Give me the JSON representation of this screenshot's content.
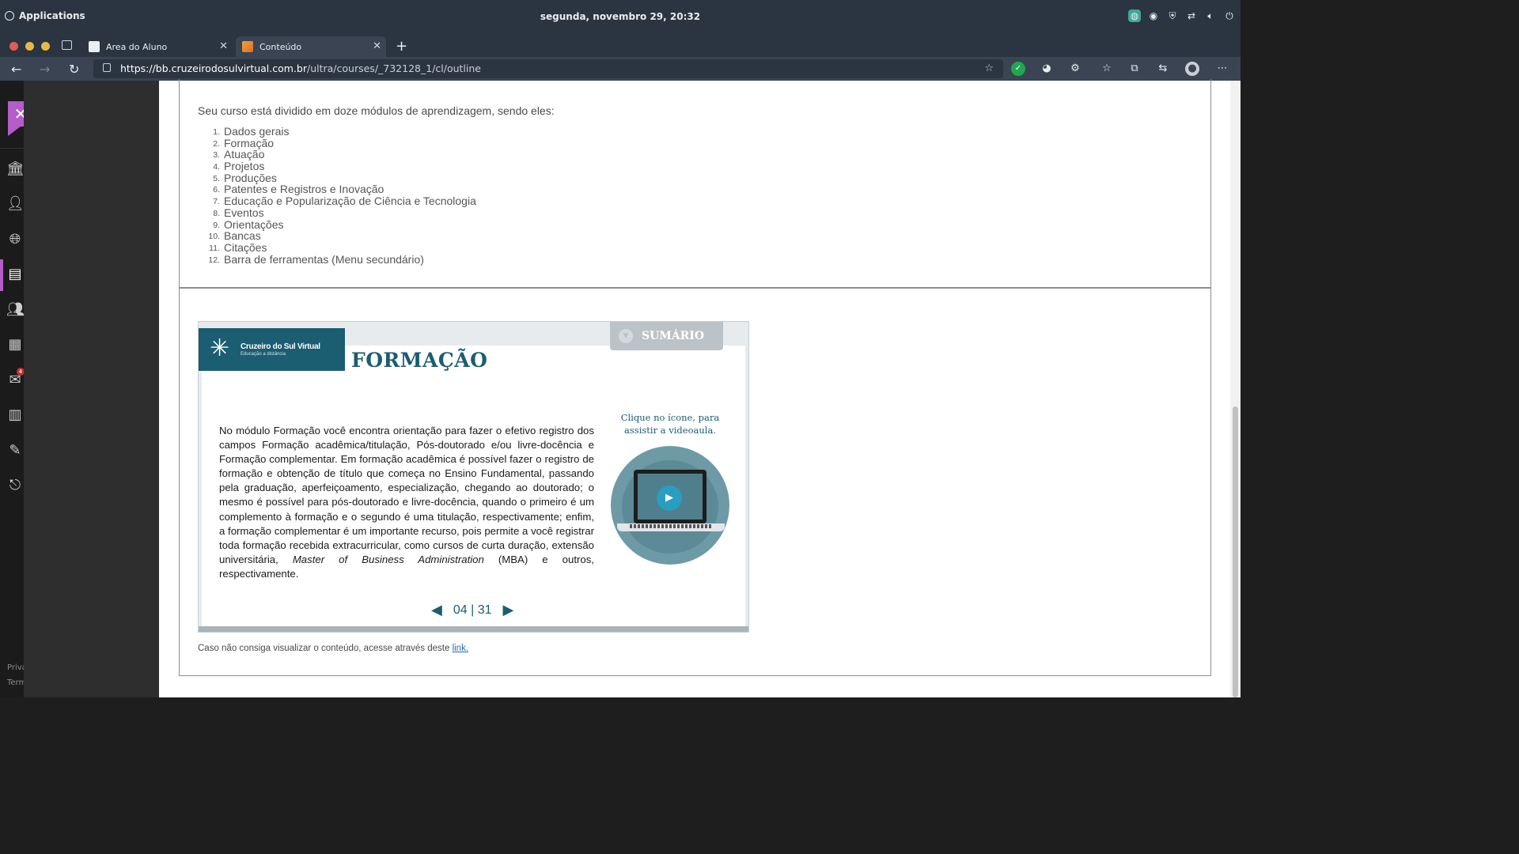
{
  "system": {
    "apps_label": "Applications",
    "clock": "segunda, novembro 29, 20:32",
    "tray_icons": [
      "browser-icon",
      "discord-icon",
      "shield-icon",
      "network-icon",
      "volume-icon",
      "power-icon"
    ]
  },
  "browser": {
    "tabs": [
      {
        "label": "Area do Aluno"
      },
      {
        "label": "Conteúdo"
      }
    ],
    "url": {
      "host": "https://bb.cruzeirodosulvirtual.com.br",
      "path": "/ultra/courses/_732128_1/cl/outline"
    }
  },
  "sidebar": {
    "footer_1": "Priva",
    "footer_2": "Term",
    "messages_badge": "4"
  },
  "content": {
    "intro": "Seu curso está dividido em doze módulos de aprendizagem, sendo eles:",
    "modules": [
      {
        "n": "1.",
        "label": "Dados gerais"
      },
      {
        "n": "2.",
        "label": "Formação"
      },
      {
        "n": "3.",
        "label": "Atuação"
      },
      {
        "n": "4.",
        "label": "Projetos"
      },
      {
        "n": "5.",
        "label": "Produções"
      },
      {
        "n": "6.",
        "label": "Patentes e Registros e Inovação"
      },
      {
        "n": "7.",
        "label": "Educação e Popularização de Ciência e Tecnologia"
      },
      {
        "n": "8.",
        "label": "Eventos"
      },
      {
        "n": "9.",
        "label": "Orientações"
      },
      {
        "n": "10.",
        "label": "Bancas"
      },
      {
        "n": "11.",
        "label": "Citações"
      },
      {
        "n": "12.",
        "label": "Barra de ferramentas (Menu secundário)"
      }
    ],
    "slide": {
      "logo_name": "Cruzeiro do Sul Virtual",
      "logo_sub": "Educação a distância",
      "sumario": "SUMÁRIO",
      "title": "FORMAÇÃO",
      "body_main": "No módulo Formação você encontra orientação para fazer o efetivo registro dos campos Formação acadêmica/titulação, Pós-doutorado e/ou livre-docência e Formação complementar. Em formação acadêmica é possível fazer o registro de formação e obtenção de título que começa no Ensino Fundamental, passando pela graduação, aperfeiçoamento, especialização, chegando ao doutorado; o mesmo é possível para pós-doutorado e livre-docência, quando o primeiro é um complemento à formação e o segundo é uma titulação, respectivamente; enfim, a formação complementar é um importante recurso, pois permite a você registrar toda formação recebida extracurricular, como cursos de curta duração, extensão universitária,",
      "body_italic": "Master of Business Administration",
      "body_end": " (MBA) e outros, respectivamente.",
      "cta": "Clique no ícone, para assistir a videoaula.",
      "page_current": "04",
      "page_sep": "|",
      "page_total": "31"
    },
    "fallback_text": "Caso não consiga visualizar o conteúdo, acesse através deste ",
    "fallback_link": "link."
  }
}
